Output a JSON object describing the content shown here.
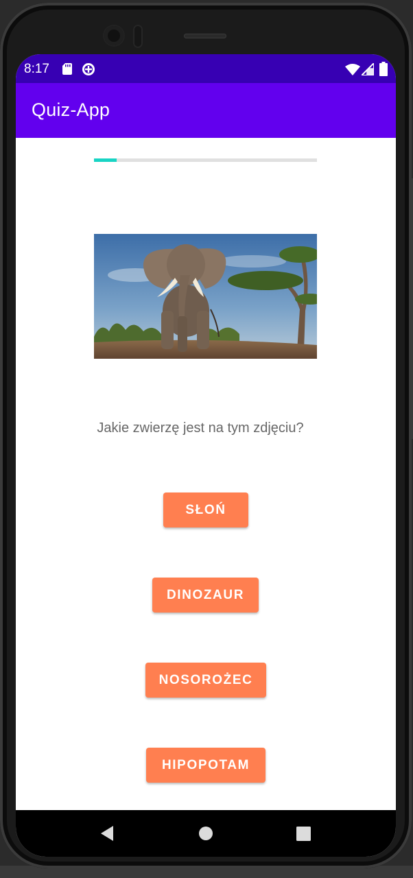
{
  "status_bar": {
    "time": "8:17",
    "icons": [
      "sd-card-icon",
      "data-saver-icon",
      "wifi-icon",
      "signal-icon",
      "battery-icon"
    ]
  },
  "app_bar": {
    "title": "Quiz-App"
  },
  "quiz": {
    "progress": 0.1,
    "image_description": "elephant",
    "question": "Jakie zwierzę jest na tym zdjęciu?",
    "answers": [
      "SŁOŃ",
      "DINOZAUR",
      "NOSOROŻEC",
      "HIPOPOTAM"
    ]
  },
  "colors": {
    "status_bar": "#3700b3",
    "app_bar": "#6200ee",
    "progress": "#18d4c4",
    "button": "#ff7f50"
  },
  "nav_bar": {
    "icons": [
      "back-icon",
      "home-icon",
      "recents-icon"
    ]
  }
}
